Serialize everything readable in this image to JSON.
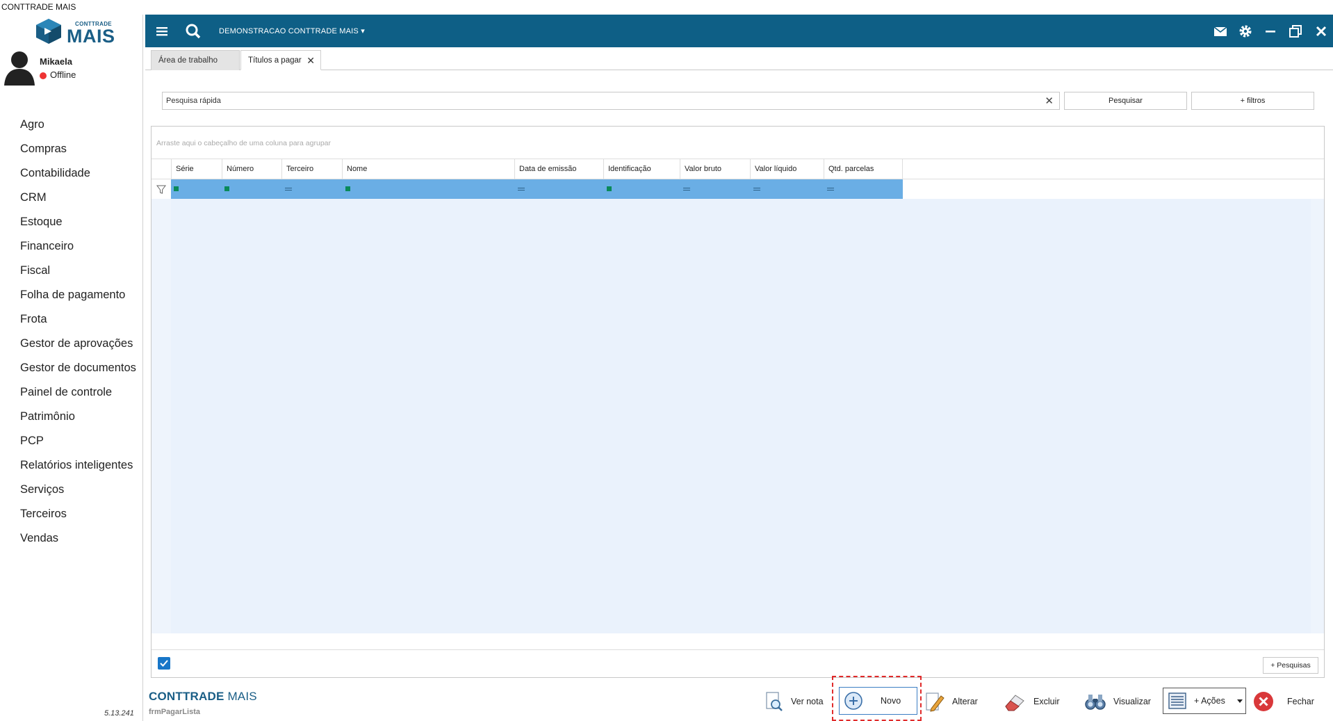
{
  "window": {
    "title": "CONTTRADE MAIS"
  },
  "logo": {
    "small": "CONTTRADE",
    "big": "MAIS"
  },
  "user": {
    "name": "Mikaela",
    "status": "Offline"
  },
  "menu": [
    "Agro",
    "Compras",
    "Contabilidade",
    "CRM",
    "Estoque",
    "Financeiro",
    "Fiscal",
    "Folha de pagamento",
    "Frota",
    "Gestor de aprovações",
    "Gestor de documentos",
    "Painel de controle",
    "Patrimônio",
    "PCP",
    "Relatórios inteligentes",
    "Serviços",
    "Terceiros",
    "Vendas"
  ],
  "version": "5.13.241",
  "topbar": {
    "company": "DEMONSTRACAO CONTTRADE MAIS ▾"
  },
  "tabs": [
    {
      "label": "Área de trabalho"
    },
    {
      "label": "Títulos a pagar",
      "close": "✕"
    }
  ],
  "search": {
    "placeholder": "Pesquisa rápida",
    "clear": "✕",
    "search_label": "Pesquisar",
    "filters_label": "+ filtros"
  },
  "grid": {
    "group_hint": "Arraste aqui o cabeçalho de uma coluna para agrupar",
    "columns": [
      "Série",
      "Número",
      "Terceiro",
      "Nome",
      "Data de emissão",
      "Identificação",
      "Valor bruto",
      "Valor líquido",
      "Qtd. parcelas"
    ],
    "more_searches": "+ Pesquisas"
  },
  "footer": {
    "brand_bold": "CONTTRADE",
    "brand_light": " MAIS",
    "form_name": "frmPagarLista",
    "actions": {
      "ver_nota": "Ver nota",
      "novo": "Novo",
      "alterar": "Alterar",
      "excluir": "Excluir",
      "visualizar": "Visualizar",
      "acoes": "+ Ações",
      "fechar": "Fechar"
    }
  },
  "colors": {
    "topbar": "#0e5f86",
    "brand": "#1a5e86",
    "filter_band": "#6aaee5",
    "highlight": "#e02a2a"
  }
}
